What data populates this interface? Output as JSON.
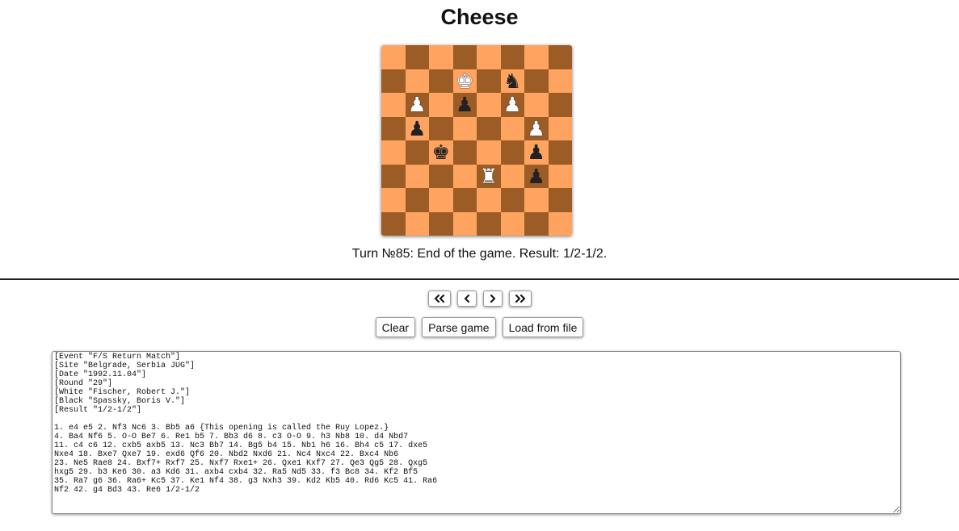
{
  "title": "Cheese",
  "board": {
    "colors": {
      "light": "#ffa360",
      "dark": "#9b5c26"
    },
    "pieces": [
      {
        "square": "d7",
        "color": "white",
        "type": "king",
        "glyph": "♚"
      },
      {
        "square": "f7",
        "color": "black",
        "type": "knight",
        "glyph": "♞"
      },
      {
        "square": "b6",
        "color": "white",
        "type": "pawn",
        "glyph": "♟"
      },
      {
        "square": "d6",
        "color": "black",
        "type": "pawn",
        "glyph": "♟"
      },
      {
        "square": "f6",
        "color": "white",
        "type": "pawn",
        "glyph": "♟"
      },
      {
        "square": "b5",
        "color": "black",
        "type": "pawn",
        "glyph": "♟"
      },
      {
        "square": "g5",
        "color": "white",
        "type": "pawn",
        "glyph": "♟"
      },
      {
        "square": "c4",
        "color": "black",
        "type": "king",
        "glyph": "♚"
      },
      {
        "square": "g4",
        "color": "black",
        "type": "pawn",
        "glyph": "♟"
      },
      {
        "square": "e3",
        "color": "white",
        "type": "rook",
        "glyph": "♜"
      },
      {
        "square": "g3",
        "color": "black",
        "type": "pawn",
        "glyph": "♟"
      }
    ]
  },
  "status": "Turn №85: End of the game. Result: 1/2-1/2.",
  "nav": {
    "first_icon": "double-chevron-left-icon",
    "prev_icon": "chevron-left-icon",
    "next_icon": "chevron-right-icon",
    "last_icon": "double-chevron-right-icon"
  },
  "actions": {
    "clear": "Clear",
    "parse": "Parse game",
    "load": "Load from file"
  },
  "pgn": "[Event \"F/S Return Match\"]\n[Site \"Belgrade, Serbia JUG\"]\n[Date \"1992.11.04\"]\n[Round \"29\"]\n[White \"Fischer, Robert J.\"]\n[Black \"Spassky, Boris V.\"]\n[Result \"1/2-1/2\"]\n\n1. e4 e5 2. Nf3 Nc6 3. Bb5 a6 {This opening is called the Ruy Lopez.}\n4. Ba4 Nf6 5. O-O Be7 6. Re1 b5 7. Bb3 d6 8. c3 O-O 9. h3 Nb8 10. d4 Nbd7\n11. c4 c6 12. cxb5 axb5 13. Nc3 Bb7 14. Bg5 b4 15. Nb1 h6 16. Bh4 c5 17. dxe5\nNxe4 18. Bxe7 Qxe7 19. exd6 Qf6 20. Nbd2 Nxd6 21. Nc4 Nxc4 22. Bxc4 Nb6\n23. Ne5 Rae8 24. Bxf7+ Rxf7 25. Nxf7 Rxe1+ 26. Qxe1 Kxf7 27. Qe3 Qg5 28. Qxg5\nhxg5 29. b3 Ke6 30. a3 Kd6 31. axb4 cxb4 32. Ra5 Nd5 33. f3 Bc8 34. Kf2 Bf5\n35. Ra7 g6 36. Ra6+ Kc5 37. Ke1 Nf4 38. g3 Nxh3 39. Kd2 Kb5 40. Rd6 Kc5 41. Ra6\nNf2 42. g4 Bd3 43. Re6 1/2-1/2"
}
